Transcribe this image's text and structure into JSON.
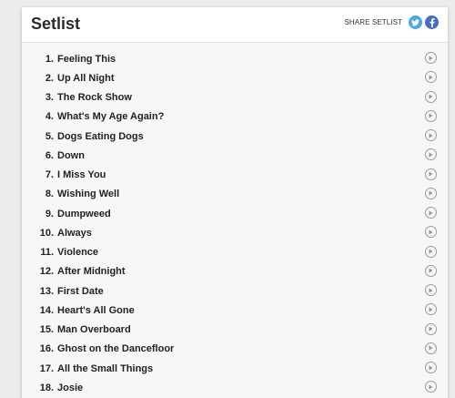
{
  "header": {
    "title": "Setlist",
    "share_label": "SHARE SETLIST",
    "twitter_icon": "twitter-icon",
    "facebook_icon": "facebook-icon",
    "twitter_color": "#4ba5e6",
    "facebook_color": "#4a6cc1"
  },
  "songs": [
    {
      "num": "1.",
      "title": "Feeling This"
    },
    {
      "num": "2.",
      "title": "Up All Night"
    },
    {
      "num": "3.",
      "title": "The Rock Show"
    },
    {
      "num": "4.",
      "title": "What's My Age Again?"
    },
    {
      "num": "5.",
      "title": "Dogs Eating Dogs"
    },
    {
      "num": "6.",
      "title": "Down"
    },
    {
      "num": "7.",
      "title": "I Miss You"
    },
    {
      "num": "8.",
      "title": "Wishing Well"
    },
    {
      "num": "9.",
      "title": "Dumpweed"
    },
    {
      "num": "10.",
      "title": "Always"
    },
    {
      "num": "11.",
      "title": "Violence"
    },
    {
      "num": "12.",
      "title": "After Midnight"
    },
    {
      "num": "13.",
      "title": "First Date"
    },
    {
      "num": "14.",
      "title": "Heart's All Gone"
    },
    {
      "num": "15.",
      "title": "Man Overboard"
    },
    {
      "num": "16.",
      "title": "Ghost on the Dancefloor"
    },
    {
      "num": "17.",
      "title": "All the Small Things"
    },
    {
      "num": "18.",
      "title": "Josie"
    }
  ],
  "play_icon": "play-circle-icon"
}
